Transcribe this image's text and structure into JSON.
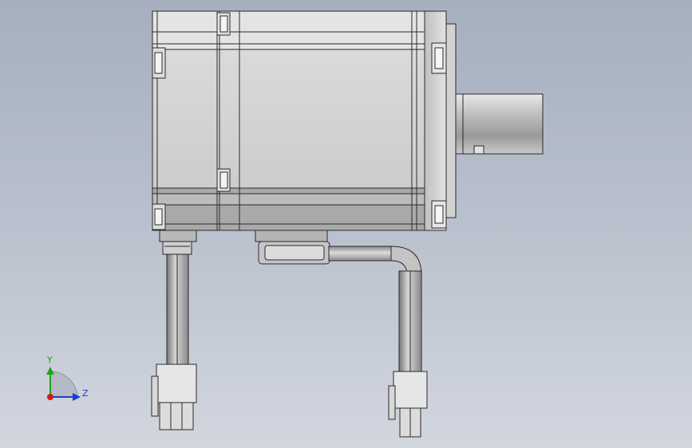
{
  "viewport": {
    "background_top": "#a6afbe",
    "background_bottom": "#d2d6df"
  },
  "model": {
    "description_icon": "servo-motor-side-view",
    "body_color": "#d4d4d4",
    "edge_color": "#2a2a2a"
  },
  "triad": {
    "y_label": "Y",
    "z_label": "Z",
    "y_color": "#1fa21f",
    "z_color": "#1a3fd0",
    "x_color": "#d01a1a"
  }
}
